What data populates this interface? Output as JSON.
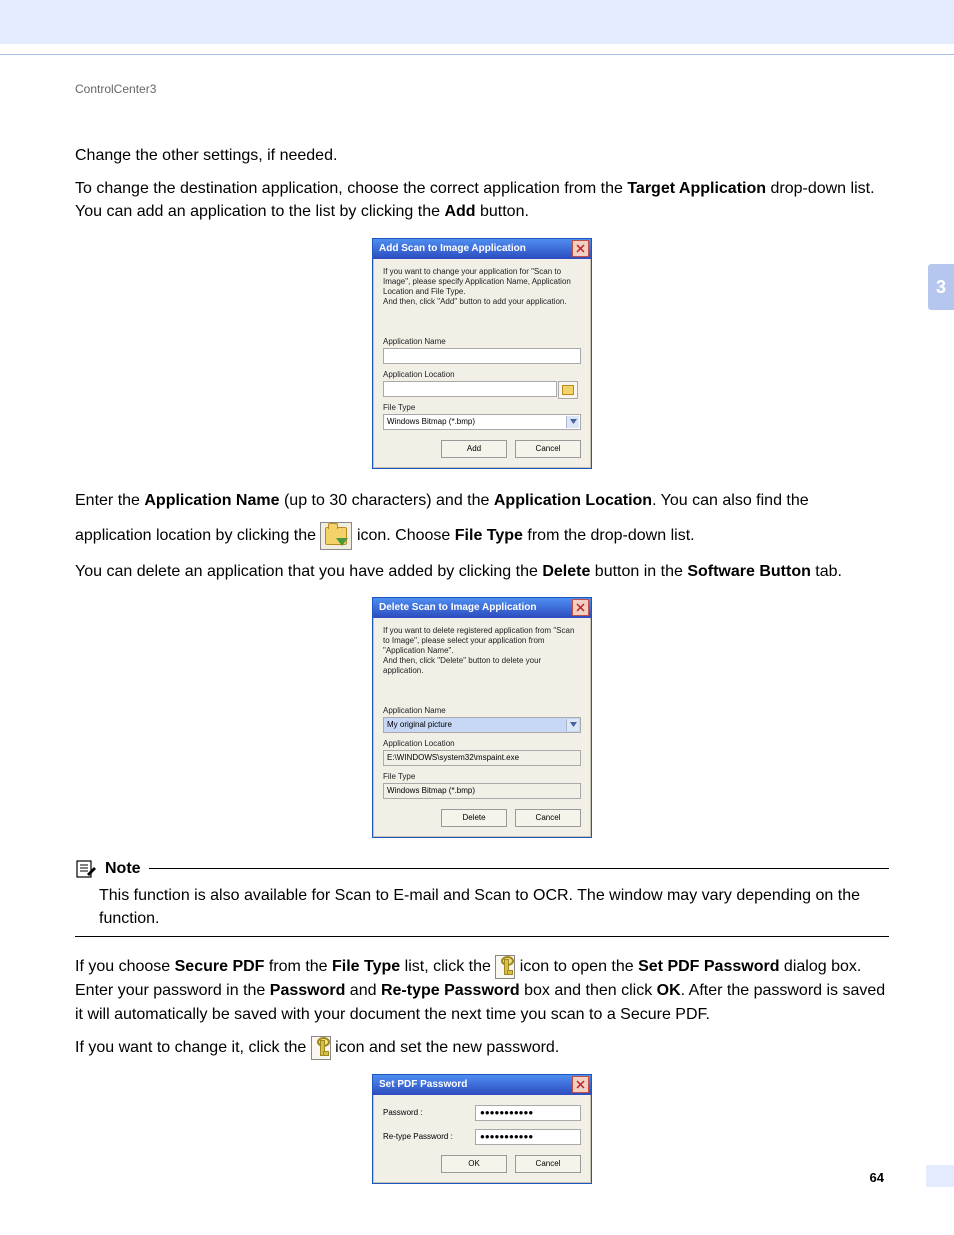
{
  "chrome": {
    "running_header": "ControlCenter3",
    "chapter_tab": "3",
    "page_number": "64"
  },
  "paragraphs": {
    "p1": "Change the other settings, if needed.",
    "p2_a": "To change the destination application, choose the correct application from the ",
    "p2_b": "Target Application",
    "p2_c": " drop-down list. You can add an application to the list by clicking the ",
    "p2_d": "Add",
    "p2_e": " button.",
    "p3_a": "Enter the ",
    "p3_b": "Application Name",
    "p3_c": " (up to 30 characters) and the ",
    "p3_d": "Application Location",
    "p3_e": ". You can also find the ",
    "p4_a": "application location by clicking the ",
    "p4_b": " icon. Choose ",
    "p4_c": "File Type",
    "p4_d": " from the drop-down list.",
    "p5_a": "You can delete an application that you have added by clicking the ",
    "p5_b": "Delete",
    "p5_c": " button in the ",
    "p5_d": "Software Button",
    "p5_e": " tab.",
    "note_title": "Note",
    "note_body": "This function is also available for Scan to E-mail and Scan to OCR. The window may vary depending on the function.",
    "p6_a": "If you choose ",
    "p6_b": "Secure PDF",
    "p6_c": " from the ",
    "p6_d": "File Type",
    "p6_e": " list, click the ",
    "p6_f": " icon to open the ",
    "p6_g": "Set PDF Password",
    "p6_h": " dialog box. Enter your password in the ",
    "p6_i": "Password",
    "p6_j": " and ",
    "p6_k": "Re-type Password",
    "p6_l": " box and then click ",
    "p6_m": "OK",
    "p6_n": ". After the password is saved it will automatically be saved with your document the next time you scan to a Secure PDF.",
    "p7_a": "If you want to change it, click the ",
    "p7_b": " icon and set the new password."
  },
  "dialogs": {
    "add": {
      "title": "Add Scan to Image Application",
      "desc": "If you want to change your application for \"Scan to Image\", please specify Application Name, Application Location and File Type.\nAnd then, click \"Add\" button to add your application.",
      "labels": {
        "name": "Application Name",
        "location": "Application Location",
        "filetype": "File Type"
      },
      "values": {
        "name": "",
        "location": "",
        "filetype": "Windows Bitmap (*.bmp)"
      },
      "buttons": {
        "primary": "Add",
        "cancel": "Cancel"
      }
    },
    "delete": {
      "title": "Delete Scan to Image Application",
      "desc": "If you want to delete registered application from \"Scan to Image\", please select your application from \"Application Name\".\nAnd then, click \"Delete\" button to delete your application.",
      "labels": {
        "name": "Application Name",
        "location": "Application Location",
        "filetype": "File Type"
      },
      "values": {
        "name": "My original picture",
        "location": "E:\\WINDOWS\\system32\\mspaint.exe",
        "filetype": "Windows Bitmap (*.bmp)"
      },
      "buttons": {
        "primary": "Delete",
        "cancel": "Cancel"
      }
    },
    "pwd": {
      "title": "Set PDF Password",
      "labels": {
        "password": "Password :",
        "retype": "Re-type Password :"
      },
      "values": {
        "password": "●●●●●●●●●●●",
        "retype": "●●●●●●●●●●●"
      },
      "buttons": {
        "ok": "OK",
        "cancel": "Cancel"
      }
    }
  }
}
